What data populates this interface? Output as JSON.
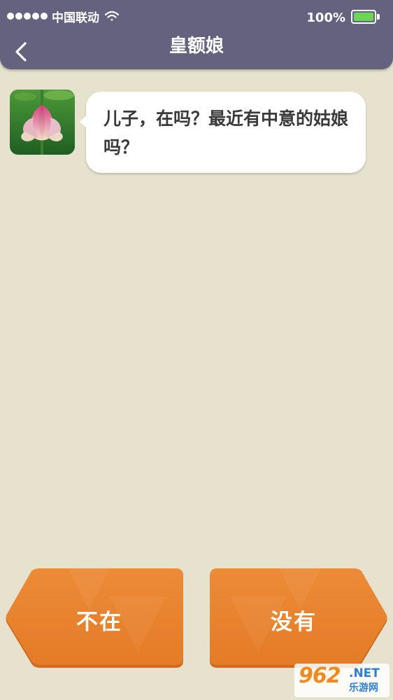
{
  "status_bar": {
    "carrier": "中国联动",
    "battery_percent": "100%",
    "battery_level": 1.0,
    "signal_bars": 5
  },
  "header": {
    "title": "皇额娘",
    "back_icon": "chevron-left-icon"
  },
  "messages": [
    {
      "sender_avatar": "lotus-flower-avatar",
      "text": "儿子，在吗？最近有中意的姑娘吗？"
    }
  ],
  "replies": {
    "left_label": "不在",
    "right_label": "没有"
  },
  "watermark": {
    "logo_text": "962",
    "suffix": ".NET",
    "subtitle": "乐游网"
  },
  "colors": {
    "header_bg": "#65627f",
    "page_bg": "#e6e2cd",
    "button_orange": "#e9832f",
    "battery_green": "#6cd55a",
    "bubble_bg": "#ffffff",
    "text_dark": "#3a3a3a"
  }
}
